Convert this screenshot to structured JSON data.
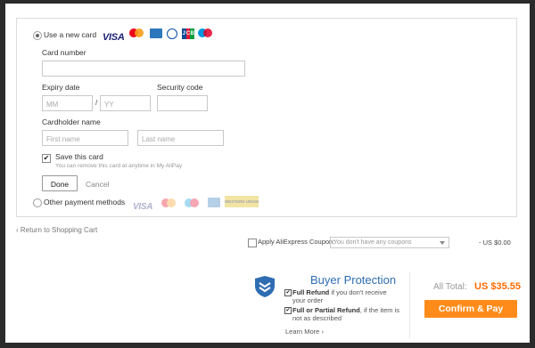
{
  "payment": {
    "new_card_label": "Use a new card",
    "card_brands": [
      "VISA",
      "MasterCard",
      "American Express",
      "Diners Club",
      "JCB",
      "Maestro"
    ],
    "card_number_label": "Card number",
    "expiry_label": "Expiry date",
    "expiry_month_placeholder": "MM",
    "expiry_separator": "/",
    "expiry_year_placeholder": "YY",
    "security_code_label": "Security code",
    "cardholder_label": "Cardholder name",
    "first_name_placeholder": "First name",
    "last_name_placeholder": "Last name",
    "save_card_label": "Save this card",
    "save_card_hint": "You can remove this card at anytime in My AliPay",
    "done_label": "Done",
    "cancel_label": "Cancel",
    "other_methods_label": "Other payment methods",
    "other_methods_brands": [
      "VISA",
      "MasterCard",
      "Maestro",
      "American Express",
      "WESTERN UNION"
    ]
  },
  "footer": {
    "return_link": "Return to Shopping Cart",
    "coupon_label": "Apply AliExpress Coupon:",
    "coupon_placeholder": "You don't have any coupons",
    "coupon_amount": "- US $0.00"
  },
  "protection": {
    "title": "Buyer Protection",
    "full_refund_bold": "Full Refund",
    "full_refund_text": " if you don't receive",
    "full_refund_text2": "your order",
    "partial_refund_bold": "Full or Partial Refund",
    "partial_refund_text": ", if the item is",
    "partial_refund_text2": "not as described",
    "learn_more": "Learn More"
  },
  "total": {
    "label": "All Total:",
    "amount": "US $35.55",
    "confirm_label": "Confirm & Pay"
  },
  "colors": {
    "accent_orange": "#ff8c1a",
    "price_orange": "#ff6a00",
    "brand_blue": "#2f6db3"
  }
}
